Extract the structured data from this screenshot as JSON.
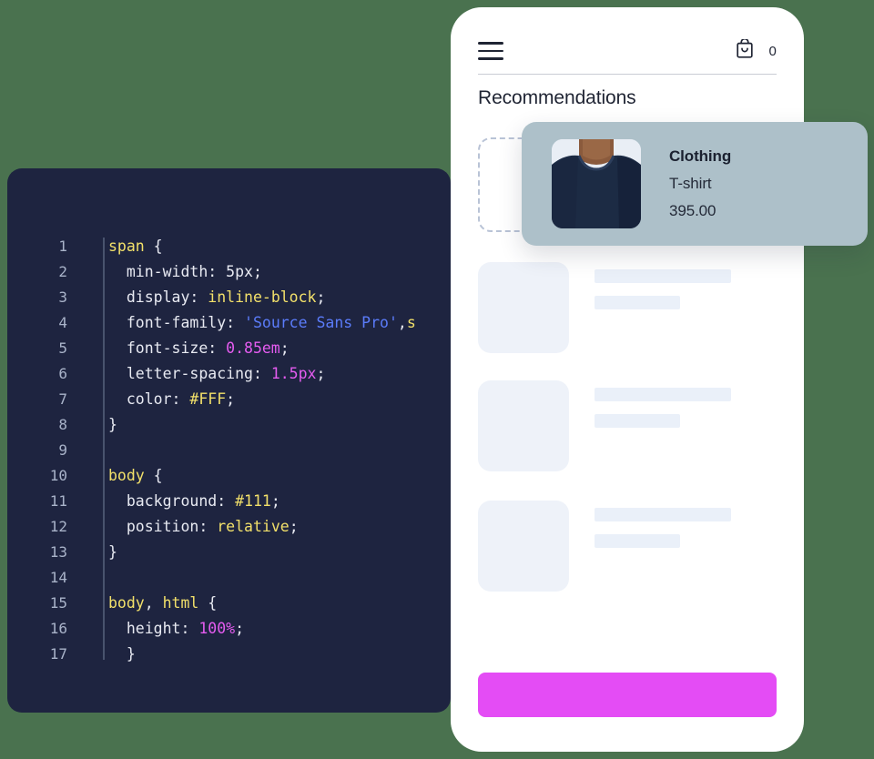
{
  "background_color": "#4a724f",
  "code_panel": {
    "background": "#1e2440",
    "lines": [
      {
        "num": "1",
        "tokens": [
          {
            "t": "span",
            "c": "sel"
          },
          {
            "t": " {",
            "c": "punct"
          }
        ],
        "indent": 0
      },
      {
        "num": "2",
        "tokens": [
          {
            "t": "  min-width: ",
            "c": "plain"
          },
          {
            "t": "5px",
            "c": "plain"
          },
          {
            "t": ";",
            "c": "punct"
          }
        ],
        "indent": 0
      },
      {
        "num": "3",
        "tokens": [
          {
            "t": "  display: ",
            "c": "plain"
          },
          {
            "t": "inline-block",
            "c": "val"
          },
          {
            "t": ";",
            "c": "punct"
          }
        ],
        "indent": 0
      },
      {
        "num": "4",
        "tokens": [
          {
            "t": "  font-family: ",
            "c": "plain"
          },
          {
            "t": "'Source Sans Pro'",
            "c": "str"
          },
          {
            "t": ",",
            "c": "punct"
          },
          {
            "t": "s",
            "c": "val"
          }
        ],
        "indent": 0
      },
      {
        "num": "5",
        "tokens": [
          {
            "t": "  font-size: ",
            "c": "plain"
          },
          {
            "t": "0.85em",
            "c": "num"
          },
          {
            "t": ";",
            "c": "punct"
          }
        ],
        "indent": 0
      },
      {
        "num": "6",
        "tokens": [
          {
            "t": "  letter-spacing: ",
            "c": "plain"
          },
          {
            "t": "1.5px",
            "c": "num"
          },
          {
            "t": ";",
            "c": "punct"
          }
        ],
        "indent": 0
      },
      {
        "num": "7",
        "tokens": [
          {
            "t": "  color: ",
            "c": "plain"
          },
          {
            "t": "#FFF",
            "c": "val"
          },
          {
            "t": ";",
            "c": "punct"
          }
        ],
        "indent": 0
      },
      {
        "num": "8",
        "tokens": [
          {
            "t": "}",
            "c": "punct"
          }
        ],
        "indent": 0
      },
      {
        "num": "9",
        "tokens": [],
        "indent": 0
      },
      {
        "num": "10",
        "tokens": [
          {
            "t": "body",
            "c": "sel"
          },
          {
            "t": " {",
            "c": "punct"
          }
        ],
        "indent": 0
      },
      {
        "num": "11",
        "tokens": [
          {
            "t": "  background: ",
            "c": "plain"
          },
          {
            "t": "#111",
            "c": "val"
          },
          {
            "t": ";",
            "c": "punct"
          }
        ],
        "indent": 0
      },
      {
        "num": "12",
        "tokens": [
          {
            "t": "  position: ",
            "c": "plain"
          },
          {
            "t": "relative",
            "c": "val"
          },
          {
            "t": ";",
            "c": "punct"
          }
        ],
        "indent": 0
      },
      {
        "num": "13",
        "tokens": [
          {
            "t": "}",
            "c": "punct"
          }
        ],
        "indent": 0
      },
      {
        "num": "14",
        "tokens": [],
        "indent": 0
      },
      {
        "num": "15",
        "tokens": [
          {
            "t": "body",
            "c": "sel"
          },
          {
            "t": ", ",
            "c": "punct"
          },
          {
            "t": "html",
            "c": "sel"
          },
          {
            "t": " {",
            "c": "punct"
          }
        ],
        "indent": 0
      },
      {
        "num": "16",
        "tokens": [
          {
            "t": "  height: ",
            "c": "plain"
          },
          {
            "t": "100%",
            "c": "num"
          },
          {
            "t": ";",
            "c": "punct"
          }
        ],
        "indent": 0
      },
      {
        "num": "17",
        "tokens": [
          {
            "t": "  }",
            "c": "punct"
          }
        ],
        "indent": 0
      }
    ]
  },
  "phone": {
    "header": {
      "menu_icon": "hamburger-menu-icon",
      "cart_icon": "shopping-bag-icon",
      "cart_count": "0"
    },
    "section_title": "Recommendations",
    "skeleton_item_count": 3,
    "cta": {
      "label": "",
      "color": "#e44cf5"
    }
  },
  "drag_card": {
    "category": "Clothing",
    "product_name": "T-shirt",
    "price": "395.00",
    "background": "#adc0c9",
    "image_alt": "navy-t-shirt-photo"
  }
}
